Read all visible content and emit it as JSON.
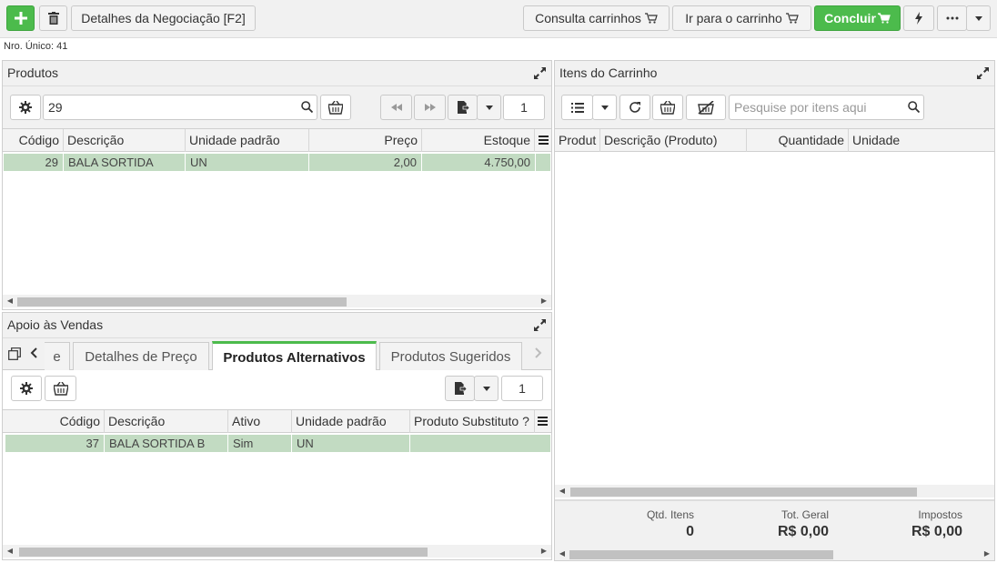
{
  "topbar": {
    "details_label": "Detalhes da Negociação [F2]",
    "consulta_label": "Consulta carrinhos",
    "ir_carrinho_label": "Ir para o carrinho",
    "concluir_label": "Concluir"
  },
  "nro_unico": "Nro. Único: 41",
  "produtos": {
    "title": "Produtos",
    "search_value": "29",
    "page": "1",
    "columns": [
      "Código",
      "Descrição",
      "Unidade padrão",
      "Preço",
      "Estoque"
    ],
    "rows": [
      {
        "codigo": "29",
        "descricao": "BALA SORTIDA",
        "unidade": "UN",
        "preco": "2,00",
        "estoque": "4.750,00"
      }
    ]
  },
  "apoio": {
    "title": "Apoio às Vendas",
    "tabs": [
      "e",
      "Detalhes de Preço",
      "Produtos Alternativos",
      "Produtos Sugeridos"
    ],
    "page": "1",
    "columns": [
      "Código",
      "Descrição",
      "Ativo",
      "Unidade padrão",
      "Produto Substituto ?"
    ],
    "rows": [
      {
        "codigo": "37",
        "descricao": "BALA SORTIDA B",
        "ativo": "Sim",
        "unidade": "UN",
        "substituto": ""
      }
    ]
  },
  "carrinho": {
    "title": "Itens do Carrinho",
    "search_placeholder": "Pesquise por itens aqui",
    "columns": [
      "Produt",
      "Descrição (Produto)",
      "Quantidade",
      "Unidade"
    ],
    "footer": {
      "qtd_label": "Qtd. Itens",
      "qtd_value": "0",
      "tot_label": "Tot. Geral",
      "tot_value": "R$ 0,00",
      "imp_label": "Impostos",
      "imp_value": "R$ 0,00"
    }
  },
  "colors": {
    "accent": "#4cbb4c",
    "row_selected": "#c2dbc2"
  },
  "icons": [
    "plus-icon",
    "trash-icon",
    "cart-icon",
    "bolt-icon",
    "ellipsis-icon",
    "caret-down-icon",
    "expand-icon",
    "gear-icon",
    "search-icon",
    "basket-icon",
    "first-page-icon",
    "last-page-icon",
    "export-icon",
    "list-icon",
    "refresh-icon",
    "remove-cart-icon",
    "copy-icon",
    "chevron-left-icon",
    "chevron-right-icon",
    "menu-icon"
  ]
}
